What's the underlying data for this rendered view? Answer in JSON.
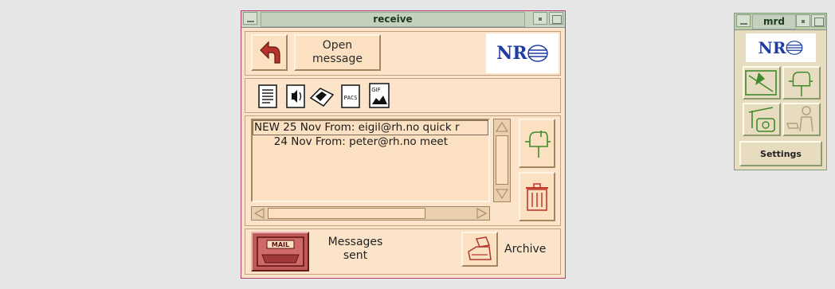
{
  "main_window": {
    "title": "receive",
    "toolbar": {
      "open_message_label": "Open\nmessage",
      "logo_text": "NR"
    },
    "attachment_icons": [
      "text-document-icon",
      "audio-icon",
      "fax-icon",
      "pacs-icon",
      "gif-image-icon"
    ],
    "pacs_label": "PACS",
    "gif_label": "GIF",
    "messages": [
      {
        "text": "NEW 25 Nov From: eigil@rh.no quick r"
      },
      {
        "text": "      24 Nov From: peter@rh.no meet"
      }
    ],
    "status": {
      "mail_label": "MAIL",
      "messages_line1": "Messages",
      "messages_line2": "sent",
      "archive_label": "Archive"
    }
  },
  "small_window": {
    "title": "mrd",
    "logo_text": "NR",
    "settings_label": "Settings"
  },
  "colors": {
    "background": "#fbe4c9",
    "accent_red": "#c0392b",
    "icon_green": "#3f8a2a",
    "logo_blue": "#1f3ca0"
  }
}
